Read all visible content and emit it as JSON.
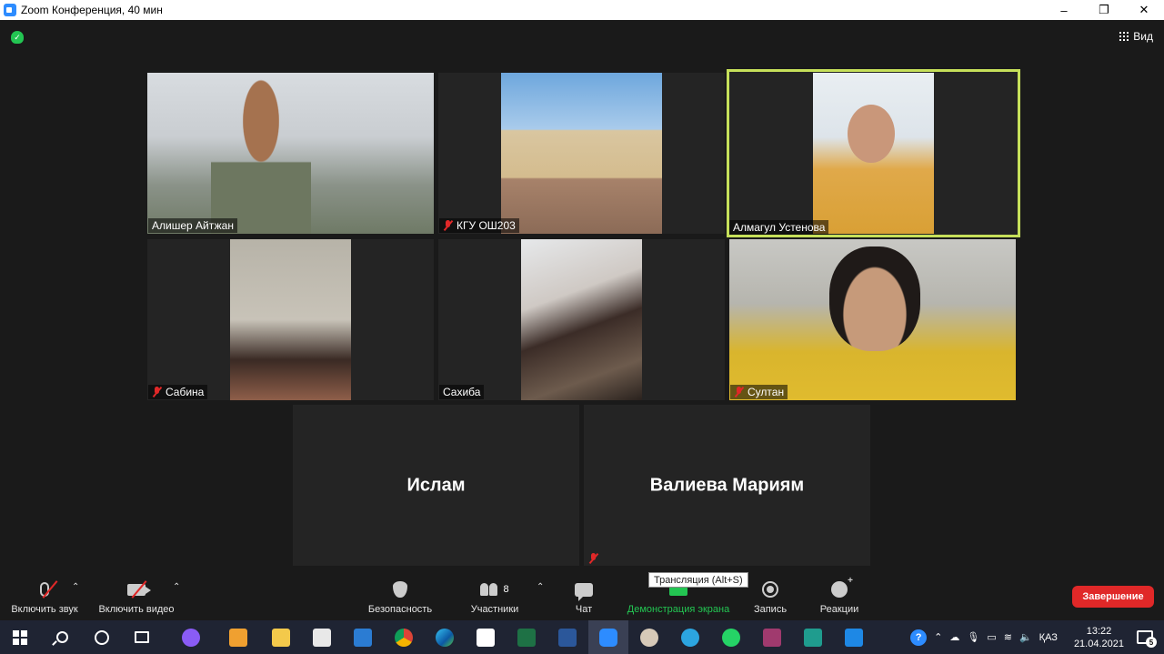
{
  "window": {
    "title": "Zoom Конференция, 40 мин",
    "controls": [
      "–",
      "❐",
      "✕"
    ]
  },
  "topbar": {
    "view_label": "Вид"
  },
  "tiles": [
    {
      "name": "Алишер Айтжан",
      "muted": false,
      "active": false
    },
    {
      "name": "КГУ ОШ203",
      "muted": true,
      "active": false
    },
    {
      "name": "Алмагул Устенова",
      "muted": false,
      "active": true
    },
    {
      "name": "Сабина",
      "muted": true,
      "active": false
    },
    {
      "name": "Сахиба",
      "muted": false,
      "active": false
    },
    {
      "name": "Султан",
      "muted": true,
      "active": false
    },
    {
      "name": "Ислам",
      "muted": false,
      "active": false,
      "video": false
    },
    {
      "name": "Валиева Мариям",
      "muted": true,
      "active": false,
      "video": false
    }
  ],
  "toolbar": {
    "audio_label": "Включить звук",
    "video_label": "Включить видео",
    "security_label": "Безопасность",
    "participants_label": "Участники",
    "participants_count": "8",
    "chat_label": "Чат",
    "share_label": "Демонстрация экрана",
    "record_label": "Запись",
    "reactions_label": "Реакции",
    "end_label": "Завершение",
    "tooltip": "Трансляция (Alt+S)"
  },
  "taskbar": {
    "lang": "ҚАЗ",
    "time": "13:22",
    "date": "21.04.2021",
    "notifications": "5",
    "apps": [
      "start",
      "search",
      "cortana",
      "task-view",
      "alice",
      "media-player",
      "file-explorer",
      "store",
      "mail",
      "chrome",
      "edge",
      "amazon",
      "excel",
      "word",
      "zoom",
      "paint",
      "telegram",
      "whatsapp",
      "winrar",
      "filmora",
      "media"
    ]
  },
  "colors": {
    "accent_green": "#23c552",
    "end_red": "#e02828",
    "active_border": "#c6e05a"
  }
}
